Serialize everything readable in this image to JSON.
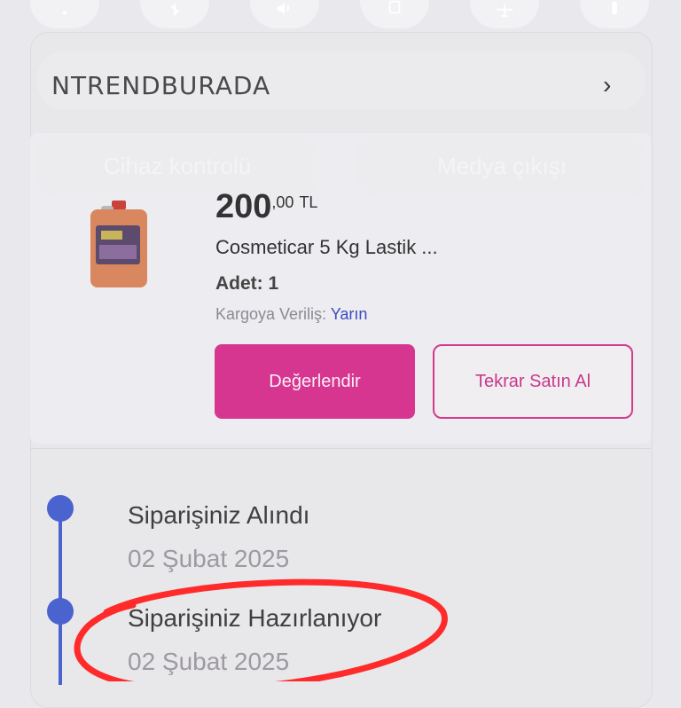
{
  "quick_settings": [
    {
      "icon": "wifi-icon"
    },
    {
      "icon": "bluetooth-icon"
    },
    {
      "icon": "volume-icon"
    },
    {
      "icon": "rotate-icon"
    },
    {
      "icon": "airplane-icon"
    },
    {
      "icon": "flashlight-icon"
    }
  ],
  "header": {
    "brand": "NTRENDBURADA",
    "close_icon": "close-icon"
  },
  "ghost_buttons": {
    "left": "Cihaz kontrolü",
    "right": "Medya çıkışı"
  },
  "order_item": {
    "price_main": "200",
    "price_decimal": ",00",
    "currency": "TL",
    "title": "Cosmeticar 5 Kg Lastik ...",
    "quantity": "Adet: 1",
    "cargo_label": "Kargoya Veriliş: ",
    "cargo_when": "Yarın",
    "review_button": "Değerlendir",
    "rebuy_button": "Tekrar Satın Al"
  },
  "timeline": [
    {
      "title": "Siparişiniz Alındı",
      "date": "02 Şubat 2025"
    },
    {
      "title": "Siparişiniz Hazırlanıyor",
      "date": "02 Şubat 2025"
    }
  ],
  "colors": {
    "accent": "#d63690",
    "timeline": "#4b63cf",
    "annotation": "#ff2a2a"
  }
}
